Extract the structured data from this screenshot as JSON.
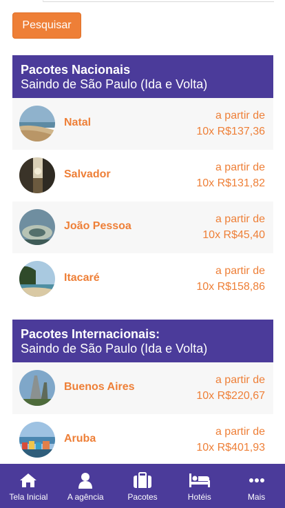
{
  "search_button": "Pesquisar",
  "sections": [
    {
      "title": "Pacotes Nacionais",
      "subtitle": "Saindo de São Paulo (Ida e Volta)",
      "items": [
        {
          "name": "Natal",
          "price_prefix": "a partir de",
          "price": "10x R$137,36"
        },
        {
          "name": "Salvador",
          "price_prefix": "a partir de",
          "price": "10x R$131,82"
        },
        {
          "name": "João Pessoa",
          "price_prefix": "a partir de",
          "price": "10x R$45,40"
        },
        {
          "name": "Itacaré",
          "price_prefix": "a partir de",
          "price": "10x R$158,86"
        }
      ]
    },
    {
      "title": "Pacotes Internacionais:",
      "subtitle": "Saindo de São Paulo (Ida e Volta)",
      "items": [
        {
          "name": "Buenos Aires",
          "price_prefix": "a partir de",
          "price": "10x R$220,67"
        },
        {
          "name": "Aruba",
          "price_prefix": "a partir de",
          "price": "10x R$401,93"
        }
      ]
    }
  ],
  "nav": [
    {
      "label": "Tela Inicial",
      "icon": "home-icon"
    },
    {
      "label": "A agência",
      "icon": "user-icon"
    },
    {
      "label": "Pacotes",
      "icon": "suitcase-icon"
    },
    {
      "label": "Hotéis",
      "icon": "bed-icon"
    },
    {
      "label": "Mais",
      "icon": "more-icon"
    }
  ],
  "colors": {
    "accent": "#ee7f37",
    "brand": "#4b3b9a",
    "row_shade": "#f7f7f7"
  }
}
